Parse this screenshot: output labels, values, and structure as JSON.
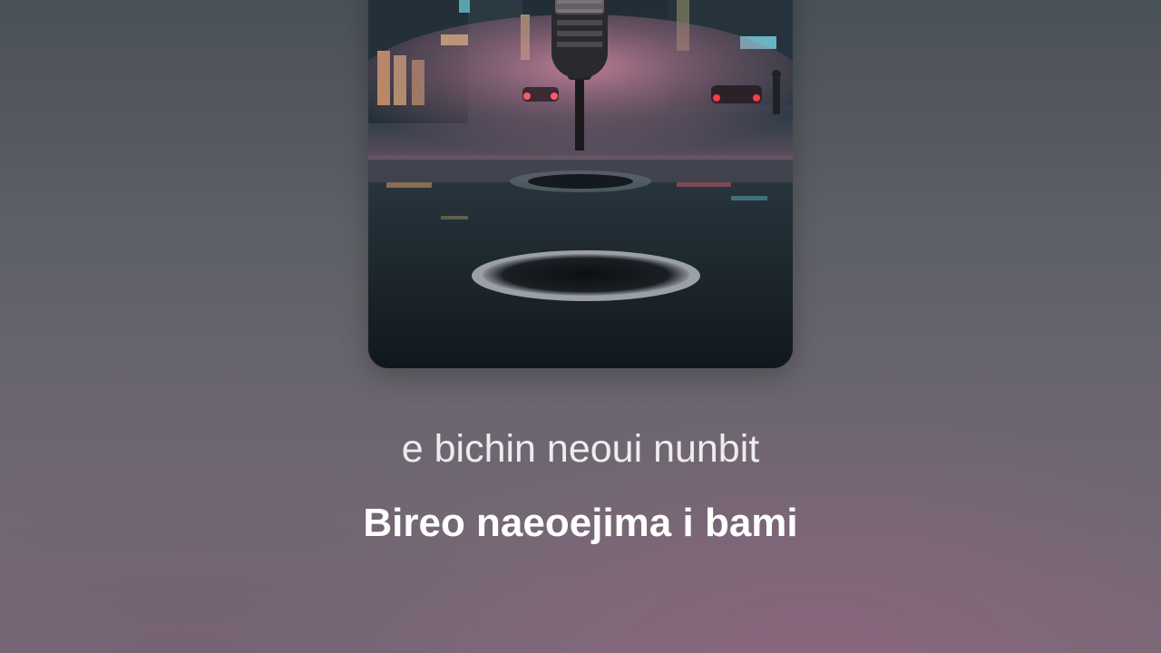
{
  "player": {
    "artwork": {
      "description_icon": "album-artwork"
    },
    "lyrics": {
      "previous_line": "e bichin neoui nunbit",
      "current_line": "Bireo naeoejima i bami"
    }
  },
  "colors": {
    "background_top": "#4a5157",
    "background_bottom": "#7a6977",
    "lyric_text": "#ffffff"
  }
}
